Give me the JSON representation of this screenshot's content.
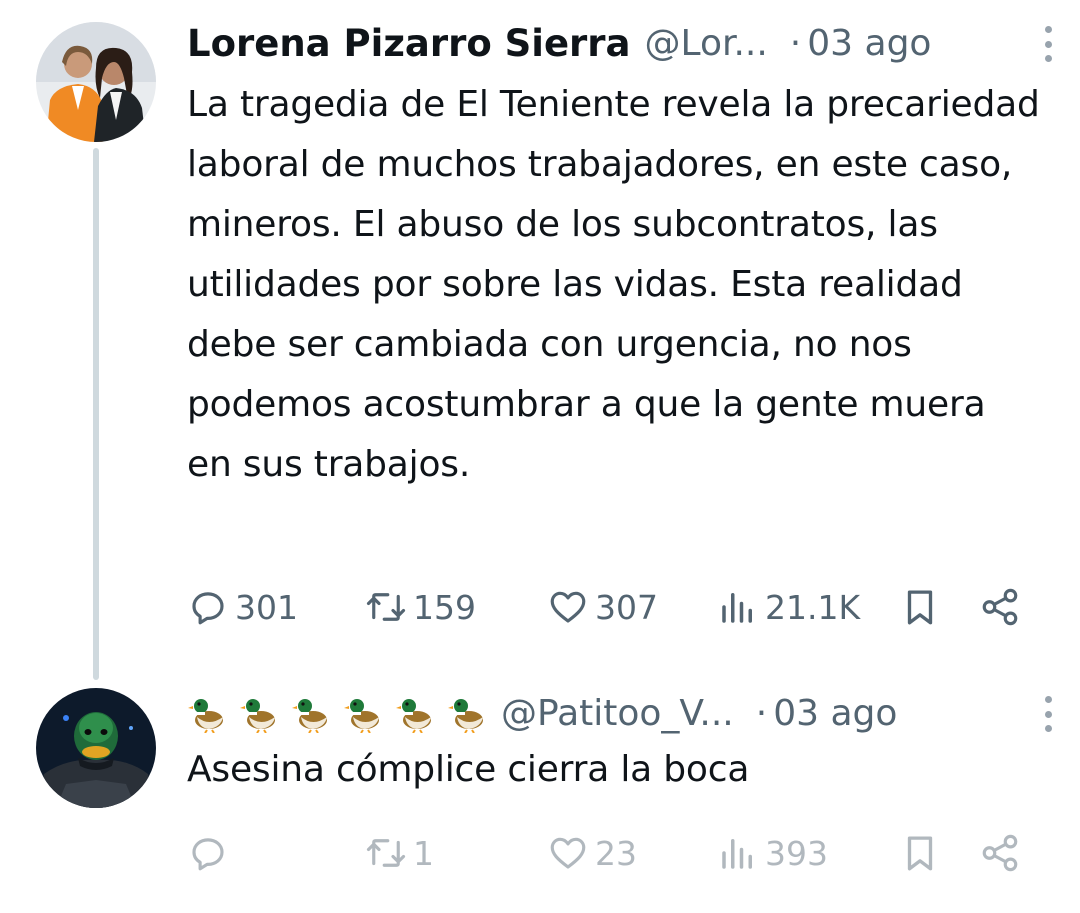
{
  "tweets": [
    {
      "author_name": "Lorena Pizarro Sierra",
      "handle": "@Lor...",
      "separator": "·",
      "date": "03 ago",
      "text": "La tragedia de El Teniente revela la precariedad laboral de muchos trabajadores, en este caso, mineros. El abuso de los subcontratos, las utilidades por sobre las vidas. Esta realidad debe ser cambiada con urgencia, no nos podemos acostumbrar a que la gente muera en sus trabajos.",
      "stats": {
        "replies": "301",
        "retweets": "159",
        "likes": "307",
        "views": "21.1K"
      }
    },
    {
      "author_name": "🦆🦆🦆🦆🦆🦆",
      "handle": "@Patitoo_V...",
      "separator": "·",
      "date": "03 ago",
      "text": "Asesina cómplice cierra la boca",
      "stats": {
        "replies": "",
        "retweets": "1",
        "likes": "23",
        "views": "393"
      }
    }
  ],
  "icons": {
    "reply": "reply-icon",
    "retweet": "retweet-icon",
    "like": "heart-icon",
    "views": "views-icon",
    "bookmark": "bookmark-icon",
    "share": "share-icon",
    "more": "more-vertical-icon"
  },
  "colors": {
    "text": "#0f1419",
    "muted": "#536471",
    "thread_line": "#cfd9de"
  }
}
